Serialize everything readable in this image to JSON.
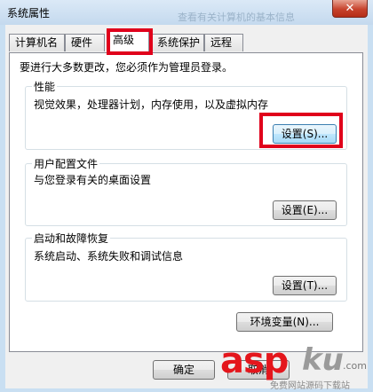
{
  "window": {
    "title": "系统属性",
    "close_glyph": "✕",
    "ghost_text": "查看有关计算机的基本信息"
  },
  "tabs": [
    {
      "label": "计算机名"
    },
    {
      "label": "硬件"
    },
    {
      "label": "高级"
    },
    {
      "label": "系统保护"
    },
    {
      "label": "远程"
    }
  ],
  "active_tab": "高级",
  "note": "要进行大多数更改，您必须作为管理员登录。",
  "performance": {
    "title": "性能",
    "desc": "视觉效果，处理器计划，内存使用，以及虚拟内存",
    "button": "设置(S)..."
  },
  "profiles": {
    "title": "用户配置文件",
    "desc": "与您登录有关的桌面设置",
    "button": "设置(E)..."
  },
  "startup": {
    "title": "启动和故障恢复",
    "desc": "系统启动、系统失败和调试信息",
    "button": "设置(T)..."
  },
  "env_button": "环境变量(N)...",
  "footer": {
    "ok": "确定",
    "cancel": "取消"
  },
  "watermark": {
    "brand": "asp",
    "ku": "ku",
    "dotcom": ".com",
    "sub": "免费网站源码下载站"
  },
  "colors": {
    "highlight": "#e0001b",
    "titlebar": "#c9dff2",
    "close": "#c7432d"
  }
}
